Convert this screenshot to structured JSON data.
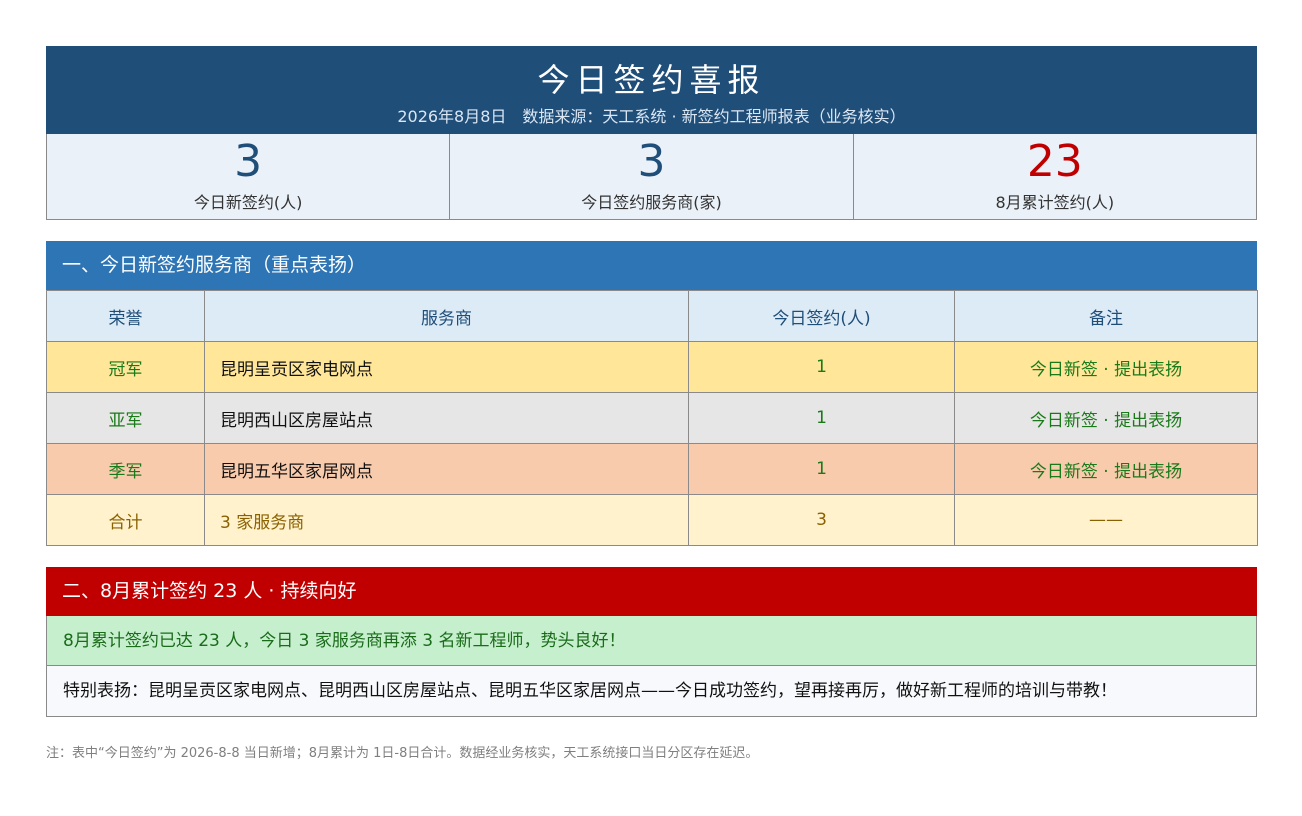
{
  "header": {
    "title": "今日签约喜报",
    "subtitle": "2026年8月8日　数据来源：天工系统 · 新签约工程师报表（业务核实）"
  },
  "stats": [
    {
      "value": "3",
      "label": "今日新签约(人)"
    },
    {
      "value": "3",
      "label": "今日签约服务商(家)"
    },
    {
      "value": "23",
      "label": "8月累计签约(人)"
    }
  ],
  "section1": {
    "heading": "一、今日新签约服务商（重点表扬）",
    "columns": [
      "荣誉",
      "服务商",
      "今日签约(人)",
      "备注"
    ],
    "rows": [
      {
        "honor": "冠军",
        "provider": "昆明呈贡区家电网点",
        "count": "1",
        "remark": "今日新签 · 提出表扬"
      },
      {
        "honor": "亚军",
        "provider": "昆明西山区房屋站点",
        "count": "1",
        "remark": "今日新签 · 提出表扬"
      },
      {
        "honor": "季军",
        "provider": "昆明五华区家居网点",
        "count": "1",
        "remark": "今日新签 · 提出表扬"
      }
    ],
    "total": {
      "honor": "合计",
      "provider": "3 家服务商",
      "count": "3",
      "remark": "——"
    }
  },
  "section2": {
    "heading": "二、8月累计签约 23 人 · 持续向好",
    "message": "8月累计签约已达 23 人，今日 3 家服务商再添 3 名新工程师，势头良好！",
    "praise": "特别表扬：昆明呈贡区家电网点、昆明西山区房屋站点、昆明五华区家居网点——今日成功签约，望再接再厉，做好新工程师的培训与带教！"
  },
  "note": "注：表中“今日签约”为 2026-8-8 当日新增；8月累计为 1日-8日合计。数据经业务核实，天工系统接口当日分区存在延迟。"
}
